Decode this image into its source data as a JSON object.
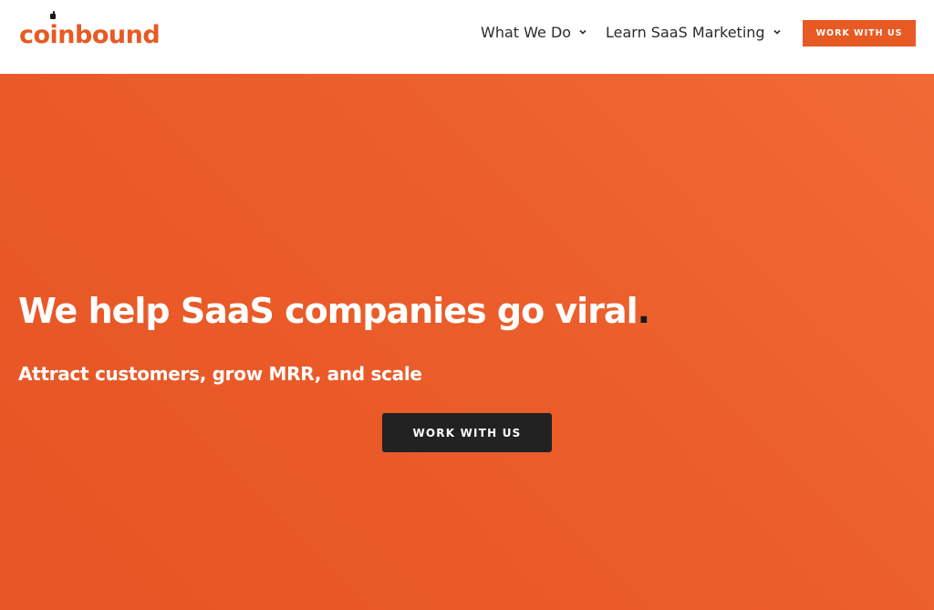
{
  "brand": {
    "logo_text": "coinbound",
    "accent_color": "#e75a24"
  },
  "nav": {
    "items": [
      {
        "label": "What We Do",
        "icon": "chevron-down-icon"
      },
      {
        "label": "Learn SaaS Marketing",
        "icon": "chevron-down-icon"
      }
    ],
    "cta_label": "WORK WITH US"
  },
  "hero": {
    "title": "We help SaaS companies go viral",
    "title_punctuation": ".",
    "subtitle": "Attract customers, grow MRR, and scale",
    "cta_label": "WORK WITH US",
    "background_color": "#eb5d2a",
    "cta_color": "#222222"
  }
}
